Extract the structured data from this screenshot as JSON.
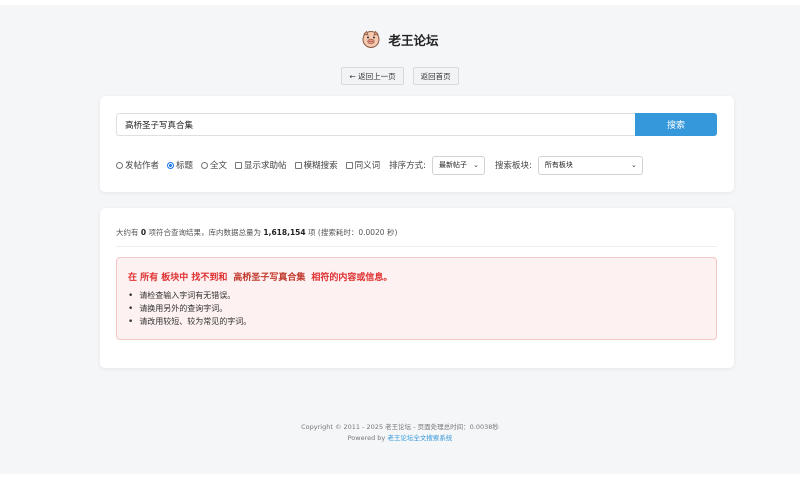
{
  "site": {
    "title": "老王论坛",
    "logo_icon": "pig-face-icon"
  },
  "nav": {
    "back_label": "← 返回上一页",
    "home_label": "返回首页"
  },
  "search": {
    "value": "高桥圣子写真合集",
    "button_label": "搜索"
  },
  "options": {
    "scope": [
      {
        "label": "发帖作者",
        "checked": false
      },
      {
        "label": "标题",
        "checked": true
      },
      {
        "label": "全文",
        "checked": false
      }
    ],
    "flags": [
      {
        "label": "显示求助帖",
        "checked": false
      },
      {
        "label": "模糊搜索",
        "checked": false
      },
      {
        "label": "同义词",
        "checked": false
      }
    ],
    "sort_label": "排序方式:",
    "sort_value": "最新帖子",
    "board_label": "搜索板块:",
    "board_value": "所有板块"
  },
  "results": {
    "prefix": "大约有",
    "count": "0",
    "middle": "项符合查询结果，库内数据总量为",
    "total": "1,618,154",
    "suffix": "项 (搜索耗时：0.0020 秒)",
    "notice_title_prefix": "在 所有 板块中 找不到和",
    "notice_keyword": "高桥圣子写真合集",
    "notice_title_suffix": "相符的内容或信息。",
    "tips": [
      "请检查输入字词有无错误。",
      "请换用另外的查询字词。",
      "请改用较短、较为常见的字词。"
    ]
  },
  "footer": {
    "copyright": "Copyright © 2011 - 2025 老王论坛 - 页面处理总时间：0.0038秒",
    "powered_prefix": "Powered by",
    "powered_link": "老王论坛全文搜索系统"
  },
  "colors": {
    "accent": "#3498db",
    "error": "#e03131",
    "notice_bg": "#fdf1f1"
  }
}
